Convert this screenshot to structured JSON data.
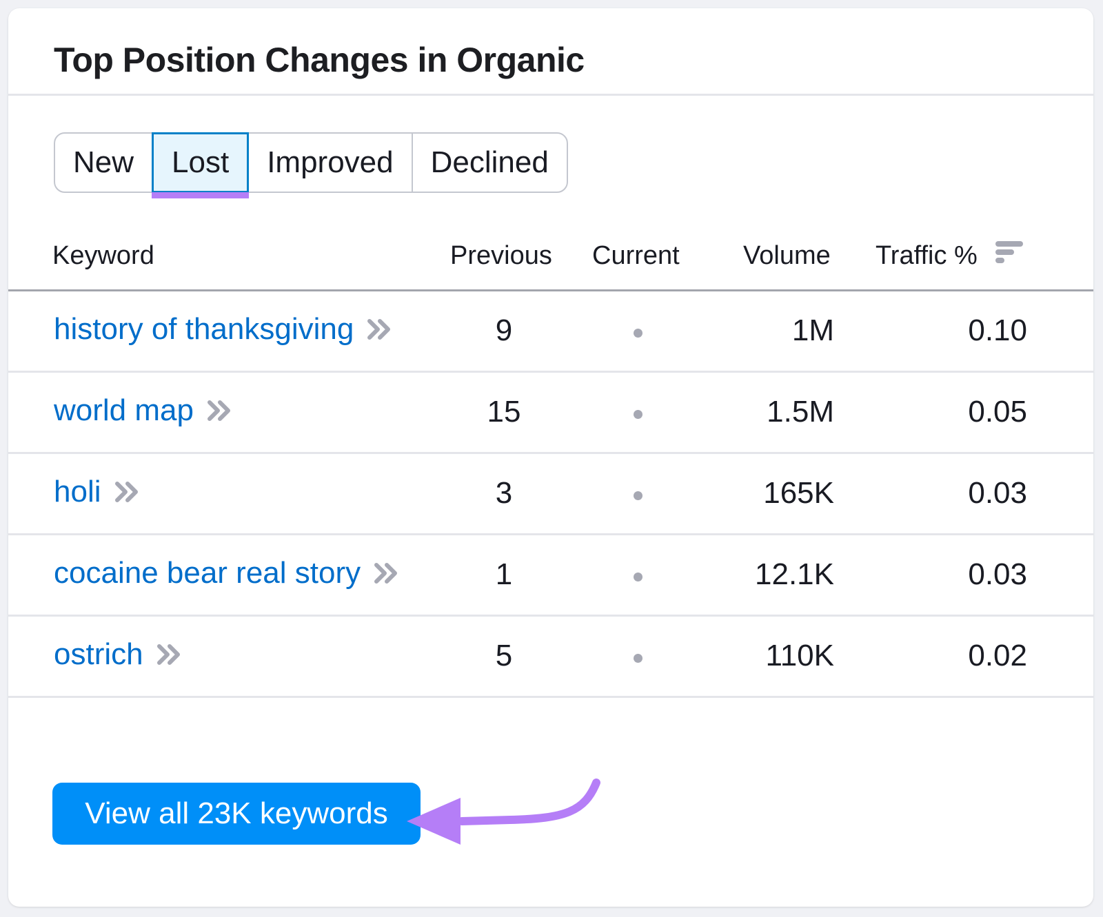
{
  "widget": {
    "title": "Top Position Changes in Organic"
  },
  "tabs": [
    {
      "label": "New",
      "active": false
    },
    {
      "label": "Lost",
      "active": true
    },
    {
      "label": "Improved",
      "active": false
    },
    {
      "label": "Declined",
      "active": false
    }
  ],
  "table": {
    "columns": {
      "keyword": "Keyword",
      "previous": "Previous",
      "current": "Current",
      "volume": "Volume",
      "traffic": "Traffic %"
    },
    "sort_icon": "sort-descending-icon",
    "rows": [
      {
        "keyword": "history of thanksgiving",
        "previous": "9",
        "current": "•",
        "volume": "1M",
        "traffic": "0.10"
      },
      {
        "keyword": "world map",
        "previous": "15",
        "current": "•",
        "volume": "1.5M",
        "traffic": "0.05"
      },
      {
        "keyword": "holi",
        "previous": "3",
        "current": "•",
        "volume": "165K",
        "traffic": "0.03"
      },
      {
        "keyword": "cocaine bear real story",
        "previous": "1",
        "current": "•",
        "volume": "12.1K",
        "traffic": "0.03"
      },
      {
        "keyword": "ostrich",
        "previous": "5",
        "current": "•",
        "volume": "110K",
        "traffic": "0.02"
      }
    ]
  },
  "footer": {
    "view_all_label": "View all 23K keywords"
  },
  "colors": {
    "link": "#006dca",
    "primary_button": "#008ff8",
    "annotation": "#b57ef7",
    "active_tab_bg": "#e6f5fd",
    "active_tab_border": "#0080c8"
  }
}
